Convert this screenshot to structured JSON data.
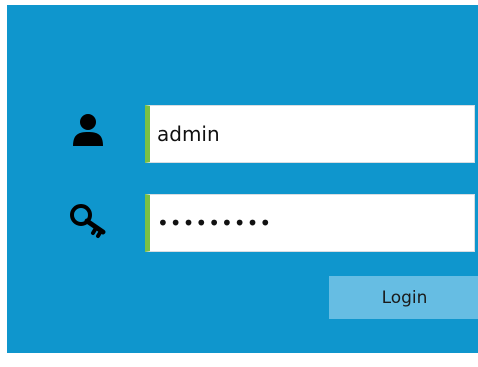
{
  "login_form": {
    "username": {
      "value": "admin",
      "icon": "user-icon"
    },
    "password": {
      "value": "•••••••••",
      "icon": "key-icon"
    },
    "login_label": "Login"
  },
  "colors": {
    "panel_background": "#0f96cd",
    "field_accent": "#7ac043",
    "button_background": "#66bde3"
  }
}
